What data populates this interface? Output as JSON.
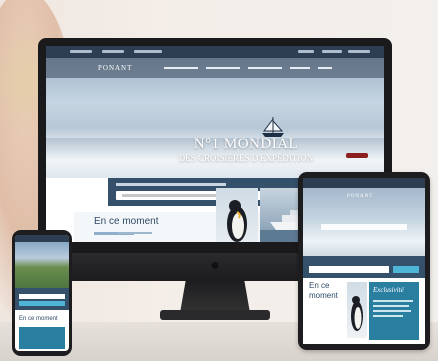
{
  "monitor": {
    "hero": {
      "logo": "PONANT",
      "title": "N°1 MONDIAL",
      "subtitle": "DES CROISIÈRES D'EXPÉDITION"
    },
    "section_title": "En ce moment"
  },
  "tablet": {
    "logo": "PONANT",
    "section_title": "En ce moment",
    "card_title": "Exclusivité"
  },
  "phone": {
    "section_title": "En ce moment"
  },
  "colors": {
    "navy": "#2d3e52",
    "search_panel": "#34506a",
    "accent": "#4fb5d6",
    "card_teal": "#2a7fa0"
  }
}
